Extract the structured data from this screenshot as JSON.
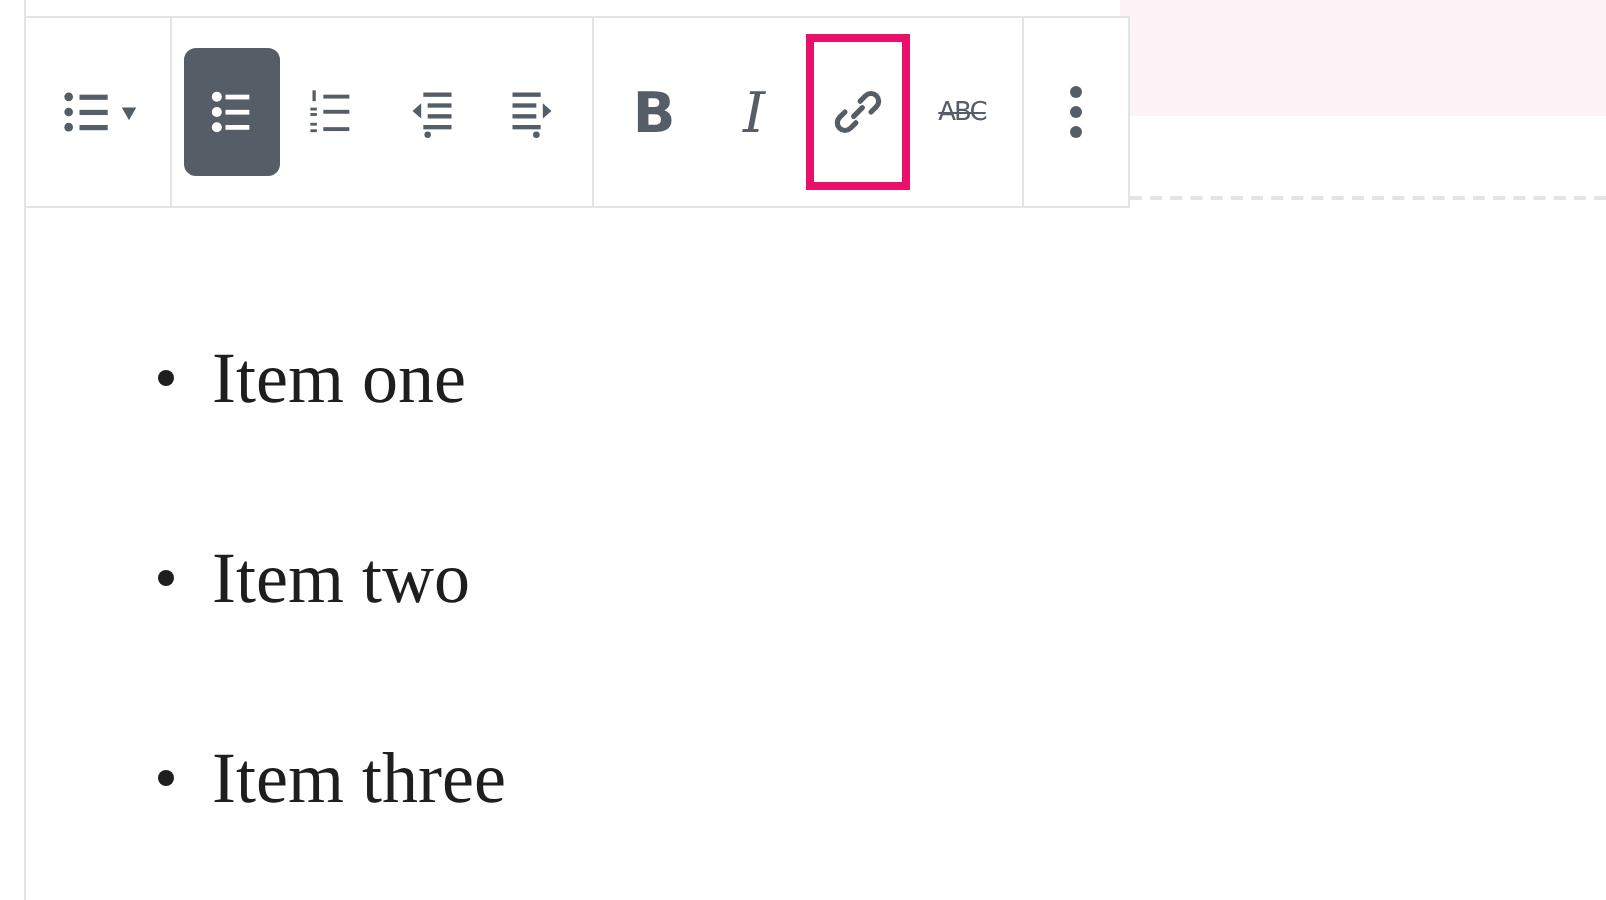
{
  "toolbar": {
    "groups": [
      {
        "buttons": [
          {
            "kind": "list-type"
          }
        ]
      },
      {
        "buttons": [
          {
            "kind": "bulleted",
            "selected": true
          },
          {
            "kind": "numbered",
            "selected": false
          },
          {
            "kind": "outdent"
          },
          {
            "kind": "indent"
          }
        ]
      },
      {
        "buttons": [
          {
            "kind": "bold",
            "label": "B",
            "highlighted": false
          },
          {
            "kind": "italic",
            "label": "I",
            "highlighted": false
          },
          {
            "kind": "link",
            "highlighted": true
          },
          {
            "kind": "strikethrough",
            "label": "ABC",
            "highlighted": false
          }
        ]
      },
      {
        "buttons": [
          {
            "kind": "more"
          }
        ]
      }
    ]
  },
  "list": {
    "items": [
      "Item one",
      "Item two",
      "Item three"
    ]
  }
}
